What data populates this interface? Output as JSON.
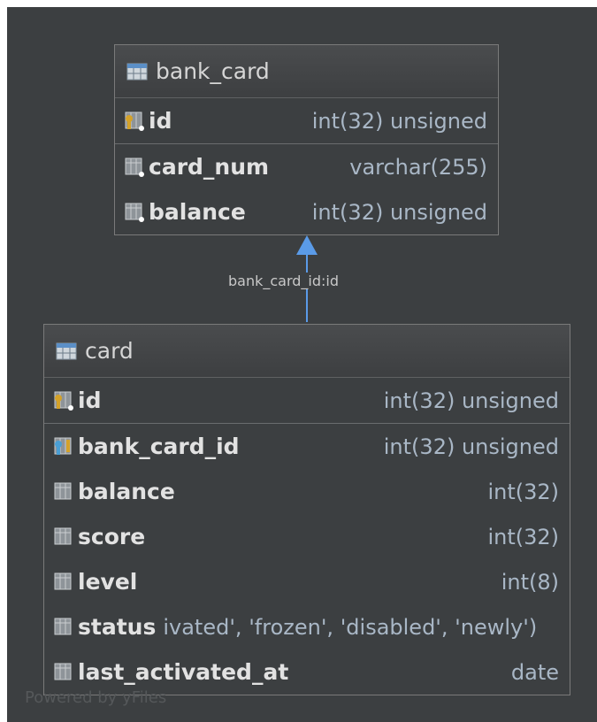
{
  "tables": [
    {
      "name": "bank_card",
      "columns": [
        {
          "name": "id",
          "type": "int(32) unsigned",
          "icon": "primary-key-column-icon"
        },
        {
          "name": "card_num",
          "type": "varchar(255)",
          "icon": "column-icon"
        },
        {
          "name": "balance",
          "type": "int(32) unsigned",
          "icon": "column-icon"
        }
      ]
    },
    {
      "name": "card",
      "columns": [
        {
          "name": "id",
          "type": "int(32) unsigned",
          "icon": "primary-key-column-icon"
        },
        {
          "name": "bank_card_id",
          "type": "int(32) unsigned",
          "icon": "foreign-key-column-icon"
        },
        {
          "name": "balance",
          "type": "int(32)",
          "icon": "column-icon"
        },
        {
          "name": "score",
          "type": "int(32)",
          "icon": "column-icon"
        },
        {
          "name": "level",
          "type": "int(8)",
          "icon": "column-icon"
        },
        {
          "name": "status",
          "type": "ivated', 'frozen', 'disabled', 'newly')",
          "icon": "column-icon"
        },
        {
          "name": "last_activated_at",
          "type": "date",
          "icon": "column-icon"
        }
      ]
    }
  ],
  "relation": {
    "label": "bank_card_id:id",
    "from": "card",
    "to": "bank_card"
  },
  "watermark": "Powered by yFiles",
  "colors": {
    "background": "#3c3f41",
    "border": "#7a7a7a",
    "arrow": "#5a9be8",
    "text": "#e2e2e2",
    "type_text": "#a9b7c6",
    "primary_key": "#d4a22a",
    "foreign_key": "#4a9fd5"
  }
}
